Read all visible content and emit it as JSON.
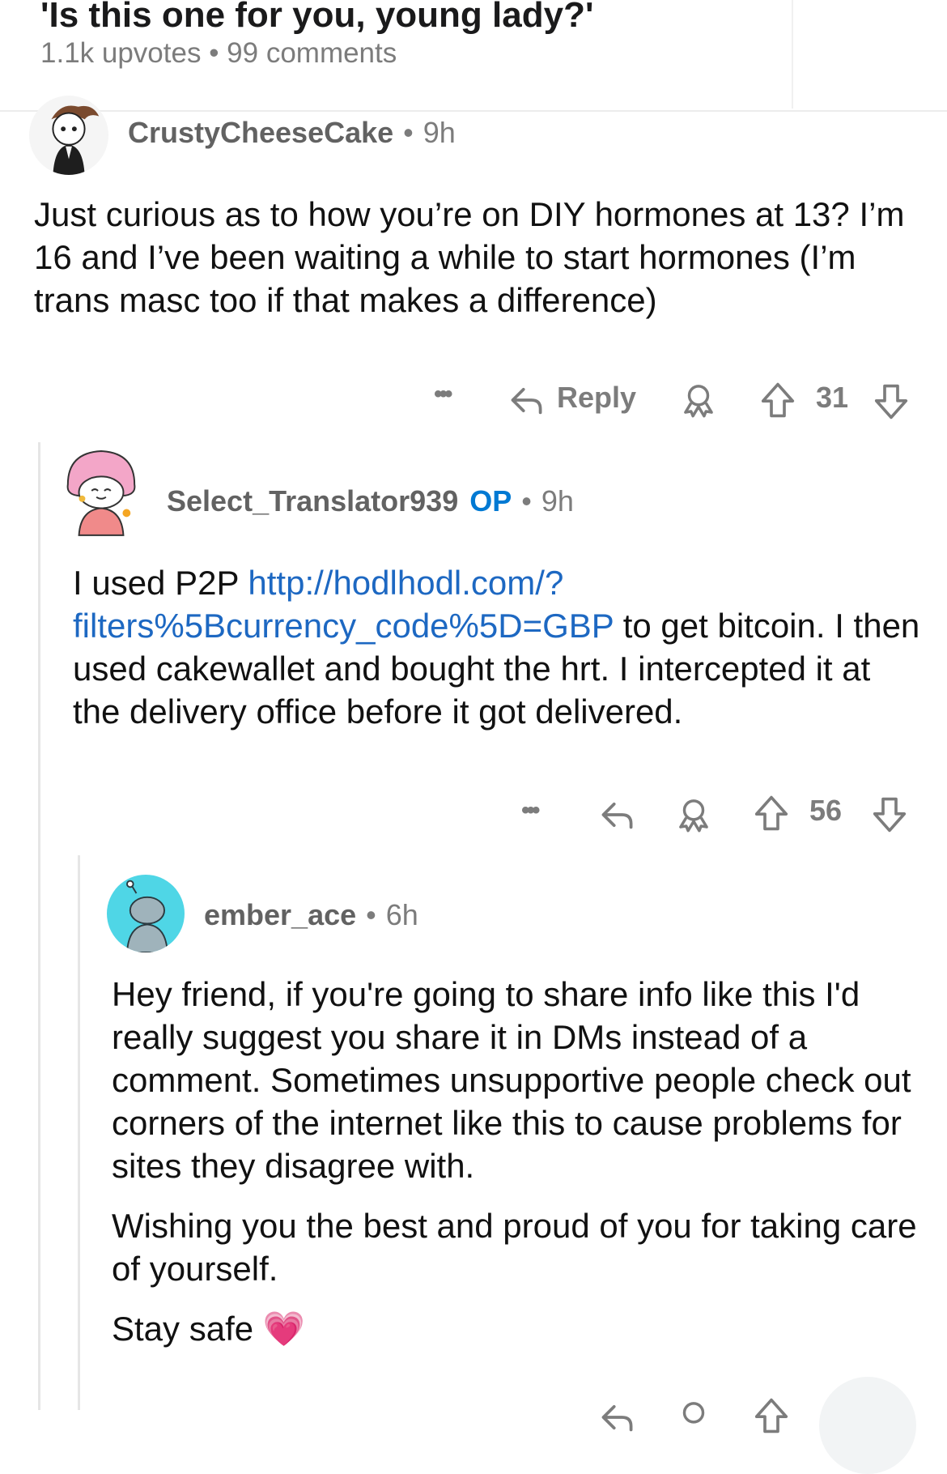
{
  "post": {
    "title": "'Is this one for you, young lady?'",
    "meta": "1.1k upvotes • 99 comments"
  },
  "comments": [
    {
      "username": "CrustyCheeseCake",
      "op_badge": "",
      "separator": "•",
      "age": "9h",
      "body": "Just curious as to how you’re on DIY hormones at 13? I’m 16 and I’ve been waiting a while to start hormones (I’m trans masc too if that makes a difference)",
      "reply_label": "Reply",
      "score": "31",
      "more_glyph": "•••"
    },
    {
      "username": "Select_Translator939",
      "op_badge": "OP",
      "separator": "•",
      "age": "9h",
      "body_before_link": "I used P2P ",
      "link": "http://hodlhodl.com/?filters%5Bcurrency_code%5D=GBP",
      "body_after_link": " to get bitcoin. I then used cakewallet and bought the hrt. I intercepted it at the delivery office before it got delivered.",
      "score": "56",
      "more_glyph": "•••"
    },
    {
      "username": "ember_ace",
      "separator": "•",
      "age": "6h",
      "paragraphs": [
        "Hey friend, if you're going to share info like this I'd really suggest you share it in DMs instead of a comment. Sometimes unsupportive people check out corners of the internet like this to cause problems for sites they disagree with.",
        "Wishing you the best and proud of you for taking care of yourself.",
        "Stay safe"
      ],
      "emoji": "💗"
    }
  ],
  "icons": {
    "more": "more-dots-icon",
    "reply": "reply-arrow-icon",
    "award": "award-icon",
    "upvote": "upvote-arrow-icon",
    "downvote": "downvote-arrow-icon",
    "heart": "sparkling-heart-icon"
  },
  "colors": {
    "op_badge": "#0079d3",
    "link": "#1d68c2",
    "meta_gray": "#7c7c7c",
    "heart_pink": "#f05aa0"
  }
}
